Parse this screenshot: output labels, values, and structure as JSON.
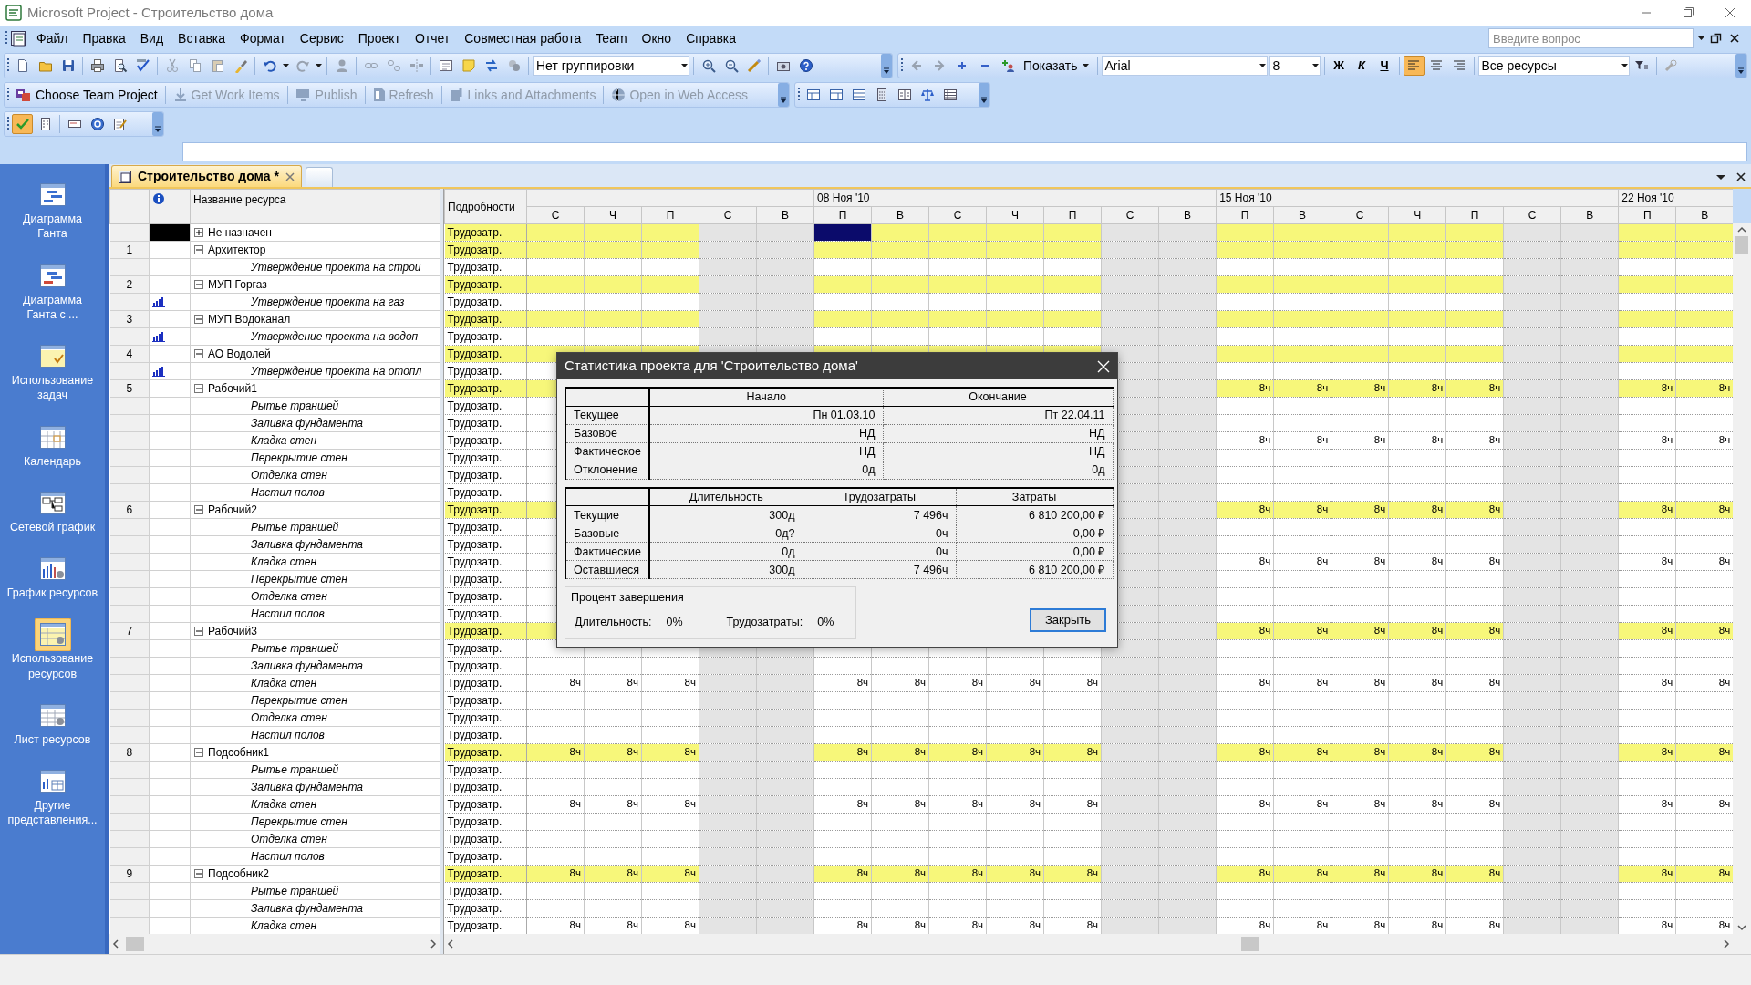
{
  "window": {
    "title": "Microsoft Project - Строительство дома"
  },
  "menu": [
    "Файл",
    "Правка",
    "Вид",
    "Вставка",
    "Формат",
    "Сервис",
    "Проект",
    "Отчет",
    "Совместная работа",
    "Team",
    "Окно",
    "Справка"
  ],
  "help_search": {
    "placeholder": "Введите вопрос"
  },
  "standard_toolbar": {
    "grouping": "Нет группировки"
  },
  "formatting_toolbar": {
    "show_menu": "Показать",
    "font": "Arial",
    "font_size": "8",
    "bold": "Ж",
    "italic": "К",
    "underline": "Ч",
    "alignment": [
      {
        "selected": true
      },
      {
        "selected": false
      },
      {
        "selected": false
      }
    ],
    "filter": "Все ресурсы"
  },
  "team_toolbar": [
    {
      "label": "Choose Team Project",
      "disabled": false
    },
    {
      "label": "Get Work Items",
      "disabled": true
    },
    {
      "label": "Publish",
      "disabled": true
    },
    {
      "label": "Refresh",
      "disabled": true
    },
    {
      "label": "Links and Attachments",
      "disabled": true
    },
    {
      "label": "Open in Web Access",
      "disabled": true
    }
  ],
  "tracking_toolbar": [
    {
      "selected": true
    },
    {
      "selected": false
    },
    {
      "selected": false
    },
    {
      "selected": false
    },
    {
      "selected": false
    }
  ],
  "view_bar": [
    {
      "label": "Диаграмма Ганта",
      "selected": false
    },
    {
      "label": "Диаграмма Ганта с ...",
      "selected": false
    },
    {
      "label": "Использование задач",
      "selected": false
    },
    {
      "label": "Календарь",
      "selected": false
    },
    {
      "label": "Сетевой график",
      "selected": false
    },
    {
      "label": "График ресурсов",
      "selected": false
    },
    {
      "label": "Использование ресурсов",
      "selected": true
    },
    {
      "label": "Лист ресурсов",
      "selected": false
    },
    {
      "label": "Другие представления...",
      "selected": false
    }
  ],
  "document_tab": {
    "title": "Строительство дома *"
  },
  "sheet": {
    "name_header": "Название ресурса",
    "details_header": "Подробности"
  },
  "timescale": [
    {
      "days": [
        {
          "label": "С",
          "weekend": false,
          "selected": false
        },
        {
          "label": "Ч",
          "weekend": false,
          "selected": false
        },
        {
          "label": "П",
          "weekend": false,
          "selected": false
        },
        {
          "label": "С",
          "weekend": true,
          "selected": false
        },
        {
          "label": "В",
          "weekend": true,
          "selected": false
        }
      ]
    },
    {
      "label": "08 Ноя '10",
      "days": [
        {
          "label": "П",
          "weekend": false,
          "selected": true
        },
        {
          "label": "В",
          "weekend": false,
          "selected": false
        },
        {
          "label": "С",
          "weekend": false,
          "selected": false
        },
        {
          "label": "Ч",
          "weekend": false,
          "selected": false
        },
        {
          "label": "П",
          "weekend": false,
          "selected": false
        },
        {
          "label": "С",
          "weekend": true,
          "selected": false
        },
        {
          "label": "В",
          "weekend": true,
          "selected": false
        }
      ]
    },
    {
      "label": "15 Ноя '10",
      "days": [
        {
          "label": "П",
          "weekend": false,
          "selected": false
        },
        {
          "label": "В",
          "weekend": false,
          "selected": false
        },
        {
          "label": "С",
          "weekend": false,
          "selected": false
        },
        {
          "label": "Ч",
          "weekend": false,
          "selected": false
        },
        {
          "label": "П",
          "weekend": false,
          "selected": false
        },
        {
          "label": "С",
          "weekend": true,
          "selected": false
        },
        {
          "label": "В",
          "weekend": true,
          "selected": false
        }
      ]
    },
    {
      "label": "22 Ноя '10",
      "days": [
        {
          "label": "П",
          "weekend": false,
          "selected": false
        },
        {
          "label": "В",
          "weekend": false,
          "selected": false
        }
      ]
    }
  ],
  "resources": [
    {
      "name": "Не назначен",
      "expanded": false,
      "details": "Трудозатр.",
      "selected": true
    },
    {
      "id": "1",
      "name": "Архитектор",
      "expanded": true,
      "details": "Трудозатр.",
      "selected": false,
      "children": [
        {
          "name": "Утверждение проекта на строи",
          "details": "Трудозатр.",
          "selected": false
        }
      ]
    },
    {
      "id": "2",
      "name": "МУП Горгаз",
      "expanded": true,
      "details": "Трудозатр.",
      "selected": false,
      "children": [
        {
          "name": "Утверждение проекта на газ",
          "kind": "graph",
          "details": "Трудозатр.",
          "selected": false
        }
      ]
    },
    {
      "id": "3",
      "name": "МУП Водоканал",
      "expanded": true,
      "details": "Трудозатр.",
      "selected": false,
      "children": [
        {
          "name": "Утверждение проекта на водоп",
          "kind": "graph",
          "details": "Трудозатр.",
          "selected": false
        }
      ]
    },
    {
      "id": "4",
      "name": "АО Водолей",
      "expanded": true,
      "details": "Трудозатр.",
      "selected": false,
      "children": [
        {
          "name": "Утверждение проекта на отопл",
          "kind": "graph",
          "details": "Трудозатр.",
          "selected": false
        }
      ]
    },
    {
      "id": "5",
      "name": "Рабочий1",
      "expanded": true,
      "details": "Трудозатр.",
      "selected": false,
      "cells": [
        null,
        null,
        null,
        null,
        null,
        null,
        null,
        null,
        null,
        null,
        null,
        null,
        "8ч",
        "8ч",
        "8ч",
        "8ч",
        "8ч",
        null,
        null,
        "8ч",
        "8ч"
      ],
      "children": [
        {
          "name": "Рытье траншей",
          "details": "Трудозатр.",
          "selected": false
        },
        {
          "name": "Заливка фундамента",
          "details": "Трудозатр.",
          "selected": false
        },
        {
          "name": "Кладка стен",
          "details": "Трудозатр.",
          "selected": false,
          "cells": [
            null,
            null,
            null,
            null,
            null,
            null,
            null,
            null,
            null,
            null,
            null,
            null,
            "8ч",
            "8ч",
            "8ч",
            "8ч",
            "8ч",
            null,
            null,
            "8ч",
            "8ч"
          ]
        },
        {
          "name": "Перекрытие стен",
          "details": "Трудозатр.",
          "selected": false
        },
        {
          "name": "Отделка стен",
          "details": "Трудозатр.",
          "selected": false
        },
        {
          "name": "Настил полов",
          "details": "Трудозатр.",
          "selected": false
        }
      ]
    },
    {
      "id": "6",
      "name": "Рабочий2",
      "expanded": true,
      "details": "Трудозатр.",
      "selected": false,
      "cells": [
        null,
        null,
        null,
        null,
        null,
        null,
        null,
        null,
        null,
        null,
        null,
        null,
        "8ч",
        "8ч",
        "8ч",
        "8ч",
        "8ч",
        null,
        null,
        "8ч",
        "8ч"
      ],
      "children": [
        {
          "name": "Рытье траншей",
          "details": "Трудозатр.",
          "selected": false
        },
        {
          "name": "Заливка фундамента",
          "details": "Трудозатр.",
          "selected": false
        },
        {
          "name": "Кладка стен",
          "details": "Трудозатр.",
          "selected": false,
          "cells": [
            null,
            null,
            null,
            null,
            null,
            null,
            null,
            null,
            null,
            null,
            null,
            null,
            "8ч",
            "8ч",
            "8ч",
            "8ч",
            "8ч",
            null,
            null,
            "8ч",
            "8ч"
          ]
        },
        {
          "name": "Перекрытие стен",
          "details": "Трудозатр.",
          "selected": false
        },
        {
          "name": "Отделка стен",
          "details": "Трудозатр.",
          "selected": false
        },
        {
          "name": "Настил полов",
          "details": "Трудозатр.",
          "selected": false
        }
      ]
    },
    {
      "id": "7",
      "name": "Рабочий3",
      "expanded": true,
      "details": "Трудозатр.",
      "selected": false,
      "cells": [
        null,
        null,
        null,
        null,
        null,
        null,
        null,
        null,
        null,
        null,
        null,
        null,
        "8ч",
        "8ч",
        "8ч",
        "8ч",
        "8ч",
        null,
        null,
        "8ч",
        "8ч"
      ],
      "children": [
        {
          "name": "Рытье траншей",
          "details": "Трудозатр.",
          "selected": false
        },
        {
          "name": "Заливка фундамента",
          "details": "Трудозатр.",
          "selected": false
        },
        {
          "name": "Кладка стен",
          "details": "Трудозатр.",
          "selected": false,
          "cells": [
            "8ч",
            "8ч",
            "8ч",
            null,
            null,
            "8ч",
            "8ч",
            "8ч",
            "8ч",
            "8ч",
            null,
            null,
            "8ч",
            "8ч",
            "8ч",
            "8ч",
            "8ч",
            null,
            null,
            "8ч",
            "8ч"
          ]
        },
        {
          "name": "Перекрытие стен",
          "details": "Трудозатр.",
          "selected": false
        },
        {
          "name": "Отделка стен",
          "details": "Трудозатр.",
          "selected": false
        },
        {
          "name": "Настил полов",
          "details": "Трудозатр.",
          "selected": false
        }
      ]
    },
    {
      "id": "8",
      "name": "Подсобник1",
      "expanded": true,
      "details": "Трудозатр.",
      "selected": false,
      "cells": [
        "8ч",
        "8ч",
        "8ч",
        null,
        null,
        "8ч",
        "8ч",
        "8ч",
        "8ч",
        "8ч",
        null,
        null,
        "8ч",
        "8ч",
        "8ч",
        "8ч",
        "8ч",
        null,
        null,
        "8ч",
        "8ч"
      ],
      "children": [
        {
          "name": "Рытье траншей",
          "details": "Трудозатр.",
          "selected": false
        },
        {
          "name": "Заливка фундамента",
          "details": "Трудозатр.",
          "selected": false
        },
        {
          "name": "Кладка стен",
          "details": "Трудозатр.",
          "selected": false,
          "cells": [
            "8ч",
            "8ч",
            "8ч",
            null,
            null,
            "8ч",
            "8ч",
            "8ч",
            "8ч",
            "8ч",
            null,
            null,
            "8ч",
            "8ч",
            "8ч",
            "8ч",
            "8ч",
            null,
            null,
            "8ч",
            "8ч"
          ]
        },
        {
          "name": "Перекрытие стен",
          "details": "Трудозатр.",
          "selected": false
        },
        {
          "name": "Отделка стен",
          "details": "Трудозатр.",
          "selected": false
        },
        {
          "name": "Настил полов",
          "details": "Трудозатр.",
          "selected": false
        }
      ]
    },
    {
      "id": "9",
      "name": "Подсобник2",
      "expanded": true,
      "details": "Трудозатр.",
      "selected": false,
      "cells": [
        "8ч",
        "8ч",
        "8ч",
        null,
        null,
        "8ч",
        "8ч",
        "8ч",
        "8ч",
        "8ч",
        null,
        null,
        "8ч",
        "8ч",
        "8ч",
        "8ч",
        "8ч",
        null,
        null,
        "8ч",
        "8ч"
      ],
      "children": [
        {
          "name": "Рытье траншей",
          "details": "Трудозатр.",
          "selected": false
        },
        {
          "name": "Заливка фундамента",
          "details": "Трудозатр.",
          "selected": false
        },
        {
          "name": "Кладка стен",
          "details": "Трудозатр.",
          "selected": false,
          "cells": [
            "8ч",
            "8ч",
            "8ч",
            null,
            null,
            "8ч",
            "8ч",
            "8ч",
            "8ч",
            "8ч",
            null,
            null,
            "8ч",
            "8ч",
            "8ч",
            "8ч",
            "8ч",
            null,
            null,
            "8ч",
            "8ч"
          ]
        }
      ]
    }
  ],
  "dialog": {
    "title": "Статистика проекта для 'Строительство дома'",
    "dates_table": {
      "columns": [
        "Начало",
        "Окончание"
      ],
      "rows": [
        {
          "label": "Текущее",
          "values": [
            "Пн 01.03.10",
            "Пт 22.04.11"
          ]
        },
        {
          "label": "Базовое",
          "values": [
            "НД",
            "НД"
          ]
        },
        {
          "label": "Фактическое",
          "values": [
            "НД",
            "НД"
          ]
        },
        {
          "label": "Отклонение",
          "values": [
            "0д",
            "0д"
          ]
        }
      ]
    },
    "totals_table": {
      "columns": [
        "Длительность",
        "Трудозатраты",
        "Затраты"
      ],
      "rows": [
        {
          "label": "Текущие",
          "values": [
            "300д",
            "7 496ч",
            "6 810 200,00 ₽"
          ]
        },
        {
          "label": "Базовые",
          "values": [
            "0д?",
            "0ч",
            "0,00 ₽"
          ]
        },
        {
          "label": "Фактические",
          "values": [
            "0д",
            "0ч",
            "0,00 ₽"
          ]
        },
        {
          "label": "Оставшиеся",
          "values": [
            "300д",
            "7 496ч",
            "6 810 200,00 ₽"
          ]
        }
      ]
    },
    "percent_complete": {
      "title": "Процент завершения",
      "items": [
        {
          "label": "Длительность:",
          "value": "0%"
        },
        {
          "label": "Трудозатраты:",
          "value": "0%"
        }
      ]
    },
    "close_button": "Закрыть"
  }
}
